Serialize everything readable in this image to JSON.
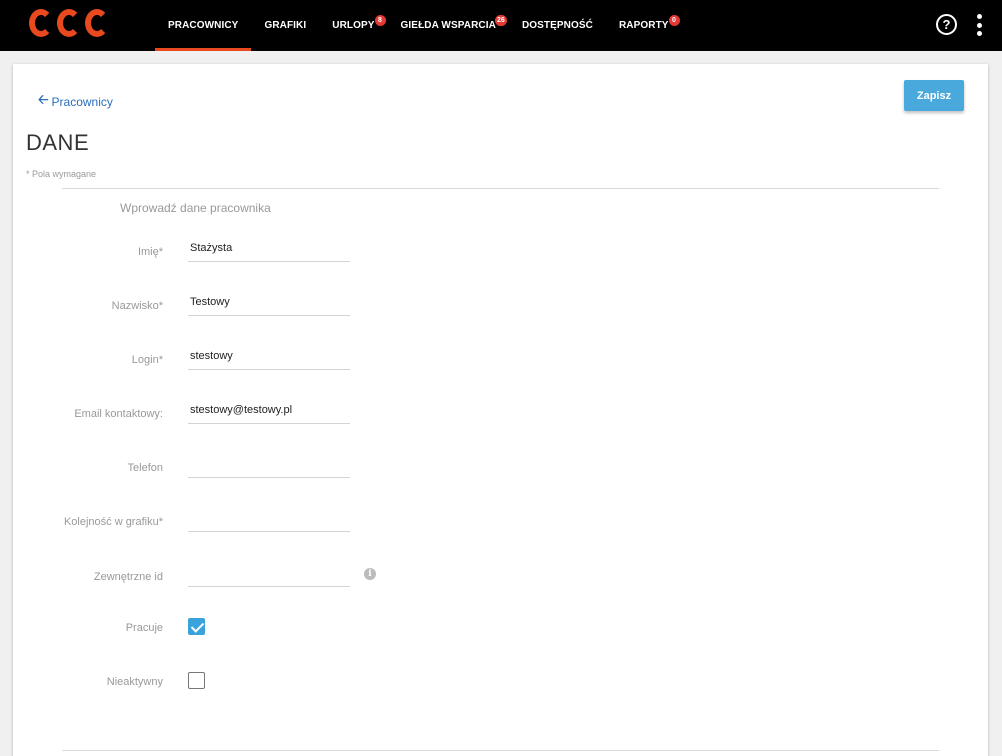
{
  "app": {
    "brand_color": "#e8491f",
    "accent_color": "#4aa9dc",
    "logo_letters": [
      "C",
      "C",
      "C"
    ]
  },
  "nav": {
    "items": [
      {
        "label": "PRACOWNICY",
        "badge": "",
        "active": true
      },
      {
        "label": "GRAFIKI",
        "badge": ""
      },
      {
        "label": "URLOPY",
        "badge": "8"
      },
      {
        "label": "GIEŁDA WSPARCIA",
        "badge": "26"
      },
      {
        "label": "DOSTĘPNOŚĆ",
        "badge": ""
      },
      {
        "label": "RAPORTY",
        "badge": "0"
      }
    ],
    "help_icon_glyph": "?"
  },
  "header": {
    "back_label": "Pracownicy",
    "save_label": "Zapisz",
    "title": "DANE",
    "required_note": "* Pola wymagane"
  },
  "form": {
    "section_title": "Wprowadź dane pracownika",
    "fields": {
      "first_name": {
        "label": "Imię*",
        "value": "Stażysta"
      },
      "last_name": {
        "label": "Nazwisko*",
        "value": "Testowy"
      },
      "login": {
        "label": "Login*",
        "value": "stestowy"
      },
      "email": {
        "label": "Email kontaktowy:",
        "value": "stestowy@testowy.pl"
      },
      "phone": {
        "label": "Telefon",
        "value": ""
      },
      "schedule_order": {
        "label": "Kolejność w grafiku*",
        "value": ""
      },
      "external_id": {
        "label": "Zewnętrzne id",
        "value": ""
      },
      "working": {
        "label": "Pracuje",
        "checked": true
      },
      "inactive": {
        "label": "Nieaktywny",
        "checked": false
      }
    }
  }
}
